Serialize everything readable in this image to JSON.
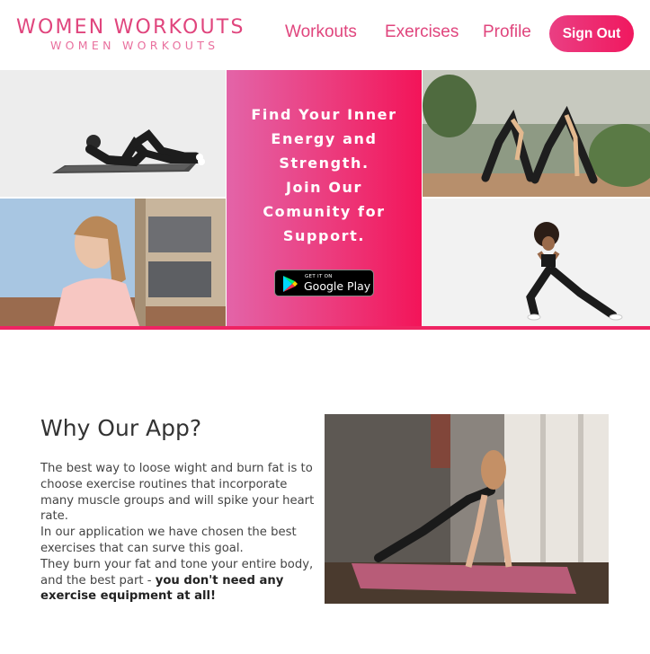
{
  "header": {
    "logo_main": "WOMEN WORKOUTS",
    "logo_sub": "WOMEN WORKOUTS",
    "nav": [
      "Workouts",
      "Exercises",
      "Profile"
    ],
    "sign_out": "Sign Out"
  },
  "hero": {
    "tagline": "Find Your Inner\nEnergy and\nStrength.\nJoin Our\nComunity for\nSupport.",
    "store_badge_small": "GET IT ON",
    "store_badge_big": "Google Play"
  },
  "section": {
    "title": "Why Our App?",
    "para1": "The best way to loose wight and burn fat is to choose exercise routines that incorporate many muscle groups and will spike your heart rate.",
    "para2": "In our application we have chosen the best exercises that can surve this goal.",
    "para3_lead": "They burn your fat and tone your entire body, and the best part - ",
    "para3_bold": "you don't need any exercise equipment at all!"
  },
  "colors": {
    "brand_pink": "#e0457d",
    "accent_red": "#f0185f"
  }
}
